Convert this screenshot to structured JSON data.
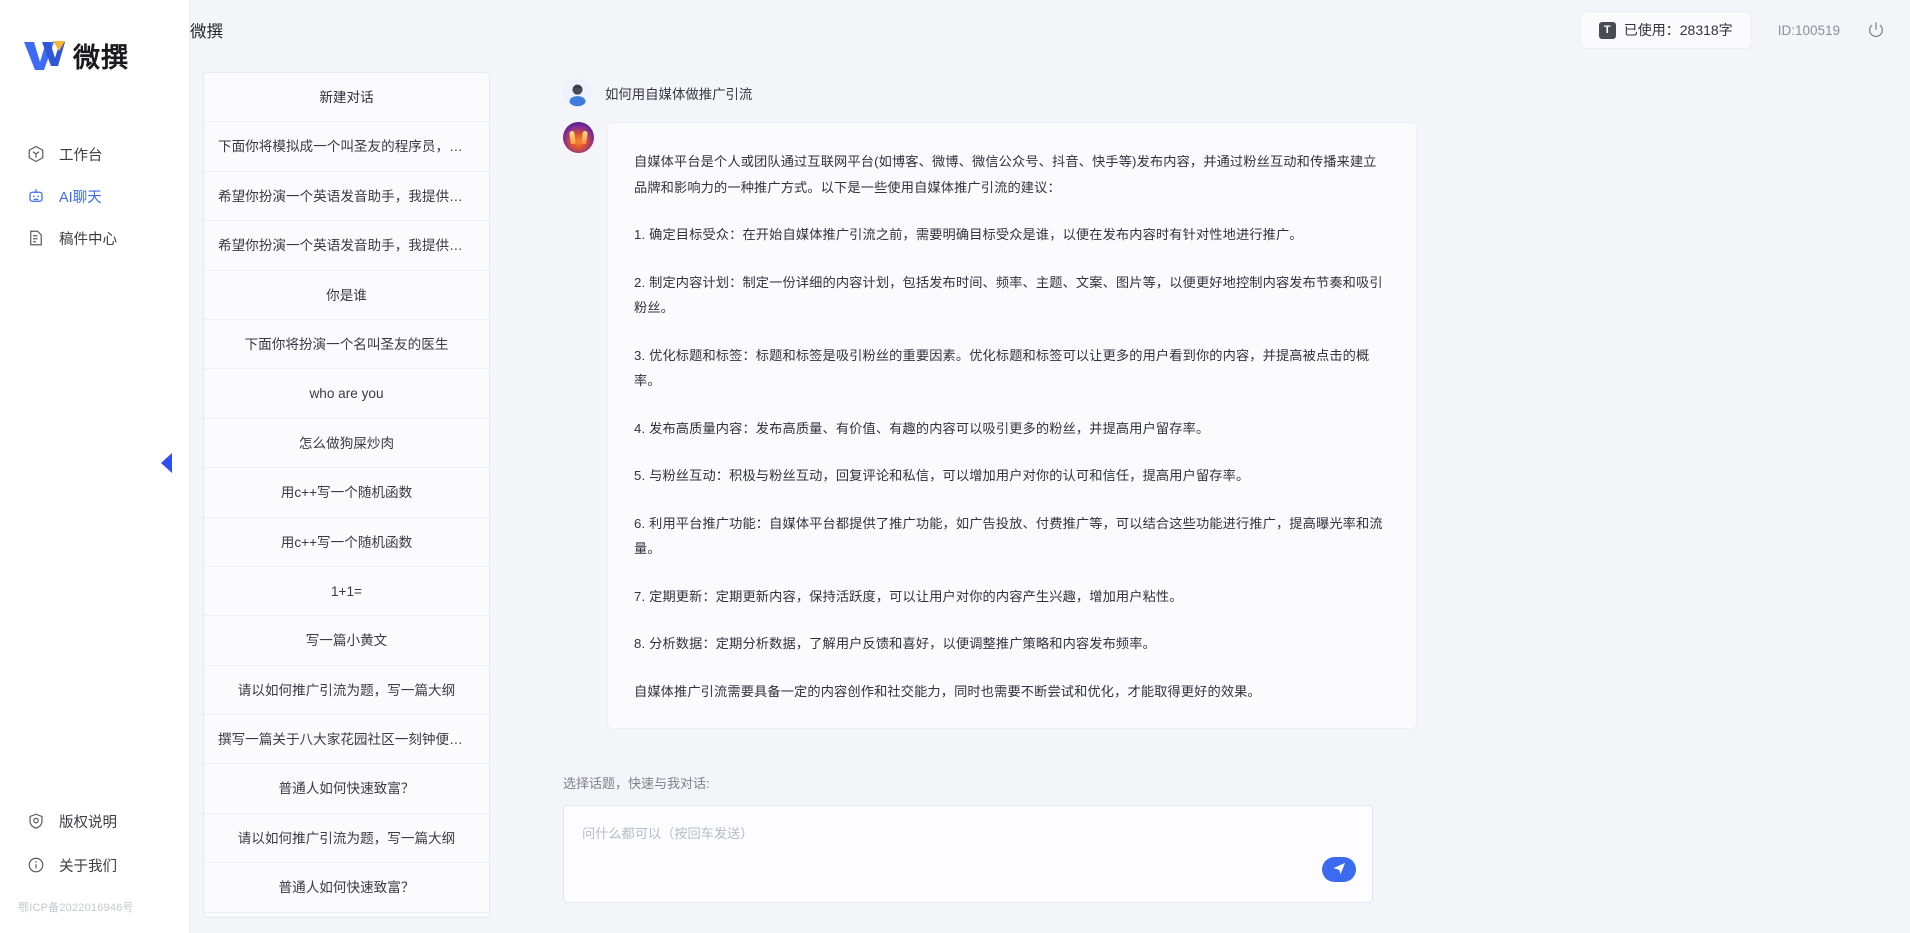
{
  "brand": {
    "name": "微撰",
    "logo_icon": "w-logo-icon"
  },
  "sidebar": {
    "items": [
      {
        "label": "工作台",
        "icon": "workbench-icon"
      },
      {
        "label": "AI聊天",
        "icon": "robot-icon"
      },
      {
        "label": "稿件中心",
        "icon": "document-edit-icon"
      }
    ],
    "bottom_items": [
      {
        "label": "版权说明",
        "icon": "shield-icon"
      },
      {
        "label": "关于我们",
        "icon": "info-icon"
      }
    ],
    "icp": "鄂ICP备2022016946号",
    "collapse_icon": "chevron-left-icon"
  },
  "header": {
    "title": "微撰",
    "usage_badge": "T",
    "usage_label": "已使用：28318字",
    "user_id": "ID:100519",
    "power_icon": "power-icon"
  },
  "conversations": {
    "new_chat_label": "新建对话",
    "items": [
      "下面你将模拟成一个叫圣友的程序员，我说...",
      "希望你扮演一个英语发音助手，我提供给你...",
      "希望你扮演一个英语发音助手，我提供给你...",
      "你是谁",
      "下面你将扮演一个名叫圣友的医生",
      "who are you",
      "怎么做狗屎炒肉",
      "用c++写一个随机函数",
      "用c++写一个随机函数",
      "1+1=",
      "写一篇小黄文",
      "请以如何推广引流为题，写一篇大纲",
      "撰写一篇关于八大家花园社区一刻钟便民生...",
      "普通人如何快速致富？",
      "请以如何推广引流为题，写一篇大纲",
      "普通人如何快速致富？"
    ]
  },
  "chat": {
    "user_avatar_icon": "user-avatar-icon",
    "ai_avatar_icon": "ai-avatar-icon",
    "user_message": "如何用自媒体做推广引流",
    "ai_paragraphs": [
      "自媒体平台是个人或团队通过互联网平台(如博客、微博、微信公众号、抖音、快手等)发布内容，并通过粉丝互动和传播来建立品牌和影响力的一种推广方式。以下是一些使用自媒体推广引流的建议：",
      "1. 确定目标受众：在开始自媒体推广引流之前，需要明确目标受众是谁，以便在发布内容时有针对性地进行推广。",
      "2. 制定内容计划：制定一份详细的内容计划，包括发布时间、频率、主题、文案、图片等，以便更好地控制内容发布节奏和吸引粉丝。",
      "3. 优化标题和标签：标题和标签是吸引粉丝的重要因素。优化标题和标签可以让更多的用户看到你的内容，并提高被点击的概率。",
      "4. 发布高质量内容：发布高质量、有价值、有趣的内容可以吸引更多的粉丝，并提高用户留存率。",
      "5. 与粉丝互动：积极与粉丝互动，回复评论和私信，可以增加用户对你的认可和信任，提高用户留存率。",
      "6. 利用平台推广功能：自媒体平台都提供了推广功能，如广告投放、付费推广等，可以结合这些功能进行推广，提高曝光率和流量。",
      "7. 定期更新：定期更新内容，保持活跃度，可以让用户对你的内容产生兴趣，增加用户粘性。",
      "8. 分析数据：定期分析数据，了解用户反馈和喜好，以便调整推广策略和内容发布频率。",
      "自媒体推广引流需要具备一定的内容创作和社交能力，同时也需要不断尝试和优化，才能取得更好的效果。"
    ]
  },
  "composer": {
    "label": "选择话题，快速与我对话:",
    "placeholder": "问什么都可以（按回车发送）",
    "value": "",
    "send_icon": "send-plane-icon"
  },
  "colors": {
    "accent": "#3b6bf0",
    "bg": "#f4f5f9",
    "panel": "#fbfbfd"
  }
}
